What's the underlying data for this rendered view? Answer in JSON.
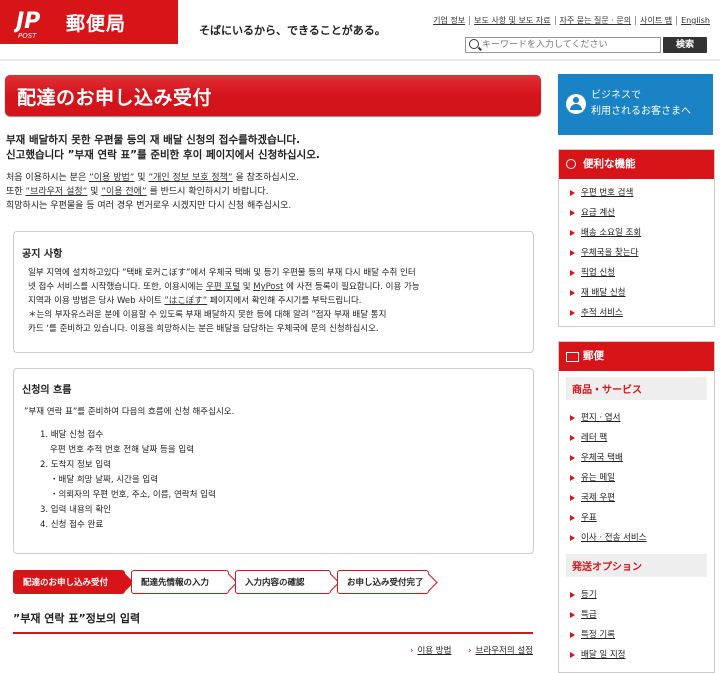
{
  "header": {
    "logo_text": "郵便局",
    "logo_sub": "POST",
    "tagline": "そばにいるから、できることがある。",
    "top_links": [
      "기업 정보",
      "보도 사항 및 보도 자료",
      "자주 묻는 질문 · 문의",
      "사이트 맵",
      "English"
    ],
    "search_placeholder": "キーワードを入力してください",
    "search_button": "検索"
  },
  "main": {
    "title": "配達のお申し込み受付",
    "lead": [
      "부재 배달하지 못한 우편물 등의 재 배달 신청의 접수를하겠습니다.",
      "신고했습니다 ”부재 연락 표”를 준비한 후이 페이지에서 신청하십시오."
    ],
    "intro": {
      "l1_a": "처음 이용하시는 분은 ",
      "l1_link1": "”이용 방법”",
      "l1_b": " 및 ",
      "l1_link2": "”개인 정보 보호 정책”",
      "l1_c": " 을 참조하십시오.",
      "l2_a": "또한 ",
      "l2_link1": "”브라우저 설정”",
      "l2_b": " 및 ",
      "l2_link2": "”이용 전에”",
      "l2_c": " 를 반드시 확인하시기 바랍니다.",
      "l3": "희망하시는 우편물을 등 여러 경우 번거로우 시겠지만 다시 신청 해주십시오."
    },
    "notice": {
      "title": "공지 사항",
      "l1": "일부 지역에 설치하고있다 ”택배 로커こぼす”에서 우체국 택배 및 등기 우편물 등의 부재 다시 배달 수취 인터",
      "l2_a": "넷 접수 서비스를 시작했습니다. 또한, 이용시에는 ",
      "l2_link1": "우편 포털",
      "l2_b": " 및 ",
      "l2_link2": "MyPost",
      "l2_c": " 에 사전 등록이 필요합니다. 이용 가능",
      "l3_a": "지역과 이용 방법은 당사 Web 사이트 ",
      "l3_link": "”はこぽす”",
      "l3_b": " 페이지에서 확인해 주시기를 부탁드립니다.",
      "l4": "＊는의 부자유스러운 분에 이용할 수 있도록 부재 배달하지 못한 등에 대해 알려 ”점자 부재 배달 통지",
      "l5": "카드 ‘를 준비하고 있습니다. 이용을 희망하시는 분은 배달을 담당하는 우체국에 문의 신청하십시오."
    },
    "flow": {
      "title": "신청의 흐름",
      "intro": "”부재 연락 표”를 준비하여 다음의 흐름에 신청 해주십시오.",
      "s1": "1. 배달 신청 접수",
      "s1_sub": "우편 번호 추적 번호 전해 날짜 등을 입력",
      "s2": "2. 도착지 정보 입력",
      "s2_sub1": "・배달 희망 날짜, 시간을 입력",
      "s2_sub2": "・의뢰자의 우편 번호, 주소, 이름, 연락처 입력",
      "s3": "3. 입력 내용의 확인",
      "s4": "4. 신청 접수 완료"
    },
    "steps": [
      "配達のお申し込み受付",
      "配達先情報の入力",
      "入力内容の確認",
      "お申し込み受付完了"
    ],
    "section_heading": "”부재 연락 표”정보의 입력",
    "bottom_links": [
      "이용 방법",
      "브라우저의 설정"
    ]
  },
  "sidebar": {
    "business": [
      "ビジネスで",
      "利用されるお客さまへ"
    ],
    "tools_title": "便利な機能",
    "tools": [
      "우편 번호 검색",
      "요금 계산",
      "배송 소요일 조회",
      "우체국을 찾는다",
      "픽업 신청",
      "재 배달 신청",
      "추적 서비스"
    ],
    "mail_title": "郵便",
    "mail_sub1": "商品・サービス",
    "mail_items": [
      "편지 · 엽서",
      "레터 팩",
      "우체국 택배",
      "유는 메일",
      "국제 우편",
      "우표",
      "이사 · 전송 서비스"
    ],
    "mail_sub2": "発送オプション",
    "mail_items2": [
      "등기",
      "특급",
      "특정 기록",
      "배달 일 지정"
    ]
  },
  "colors": {
    "brand_red": "#d71418",
    "business_blue": "#1a83c6"
  }
}
